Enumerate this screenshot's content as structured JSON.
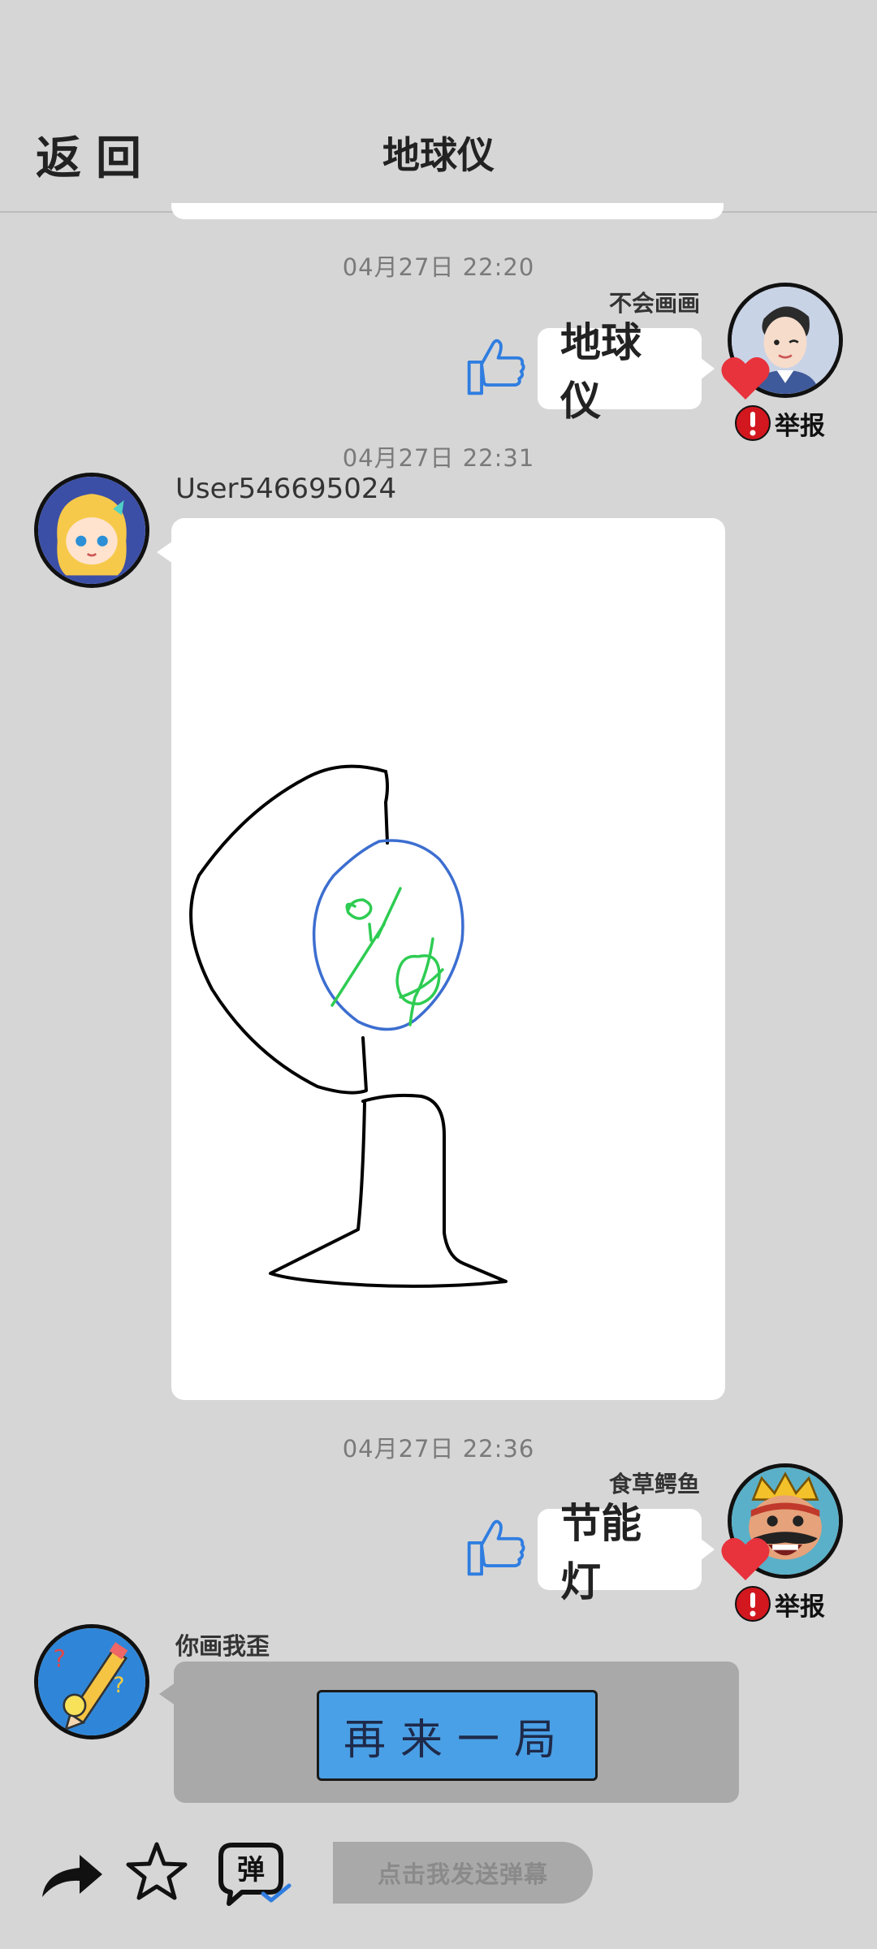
{
  "header": {
    "back_label": "返回",
    "title": "地球仪"
  },
  "messages": [
    {
      "time": "04月27日  22:20",
      "user": "不会画画",
      "text": "地球仪",
      "report": "举报",
      "avatar_icon": "cartoon-boy-avatar"
    },
    {
      "time": "04月27日  22:31",
      "user": "User546695024",
      "avatar_icon": "anime-girl-avatar",
      "content": "drawing"
    },
    {
      "time": "04月27日  22:36",
      "user": "食草鳄鱼",
      "text": "节能灯",
      "report": "举报",
      "avatar_icon": "king-avatar"
    },
    {
      "user": "你画我歪",
      "button": "再来一局",
      "avatar_icon": "pencil-app-avatar"
    }
  ],
  "toolbar": {
    "danmaku_placeholder": "点击我发送弹幕",
    "danmaku_icon_char": "弹"
  },
  "colors": {
    "background": "#d6d6d6",
    "accent_blue": "#2f7de1",
    "heart_red": "#e8323c",
    "report_red": "#d3171f"
  }
}
